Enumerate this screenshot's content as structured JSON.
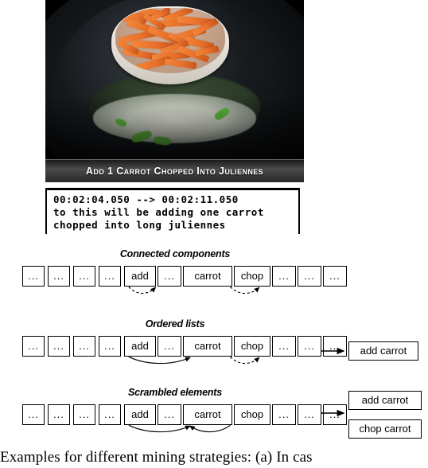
{
  "video": {
    "caption_overlay": "Add 1 Carrot Chopped Into Juliennes",
    "alt": "frame-of-cooking-video-carrots-being-added-to-wok"
  },
  "subtitle_block": {
    "timecode": "00:02:04.050 --> 00:02:11.050",
    "line1": "to this will be adding one carrot",
    "line2": "chopped into long juliennes"
  },
  "sections": [
    {
      "id": "connected-components",
      "title": "Connected components",
      "tokens": [
        "...",
        "...",
        "...",
        "...",
        "add",
        "...",
        "carrot",
        "chop",
        "...",
        "...",
        "..."
      ],
      "arrows": [
        {
          "from": "add",
          "to": "...",
          "style": "dashed"
        },
        {
          "from": "chop",
          "to": "...",
          "style": "dashed"
        }
      ],
      "results": []
    },
    {
      "id": "ordered-lists",
      "title": "Ordered lists",
      "tokens": [
        "...",
        "...",
        "...",
        "...",
        "add",
        "...",
        "carrot",
        "chop",
        "...",
        "...",
        "..."
      ],
      "arrows": [
        {
          "from": "add",
          "to": "carrot",
          "style": "solid"
        },
        {
          "from": "chop",
          "to": "...",
          "style": "dashed"
        }
      ],
      "results": [
        "add carrot"
      ]
    },
    {
      "id": "scrambled-elements",
      "title": "Scrambled elements",
      "tokens": [
        "...",
        "...",
        "...",
        "...",
        "add",
        "...",
        "carrot",
        "chop",
        "...",
        "...",
        "..."
      ],
      "arrows": [
        {
          "from": "add",
          "to": "carrot",
          "style": "solid"
        },
        {
          "from": "chop",
          "to": "carrot",
          "style": "solid"
        }
      ],
      "results": [
        "add carrot",
        "chop carrot"
      ]
    }
  ],
  "figure_caption": "Examples for different mining strategies:  (a) In cas",
  "colors": {
    "ink": "#000000",
    "page": "#ffffff",
    "carrot": "#e9712a",
    "greens": "#5fbb3e",
    "bowl": "#f2efe9"
  }
}
